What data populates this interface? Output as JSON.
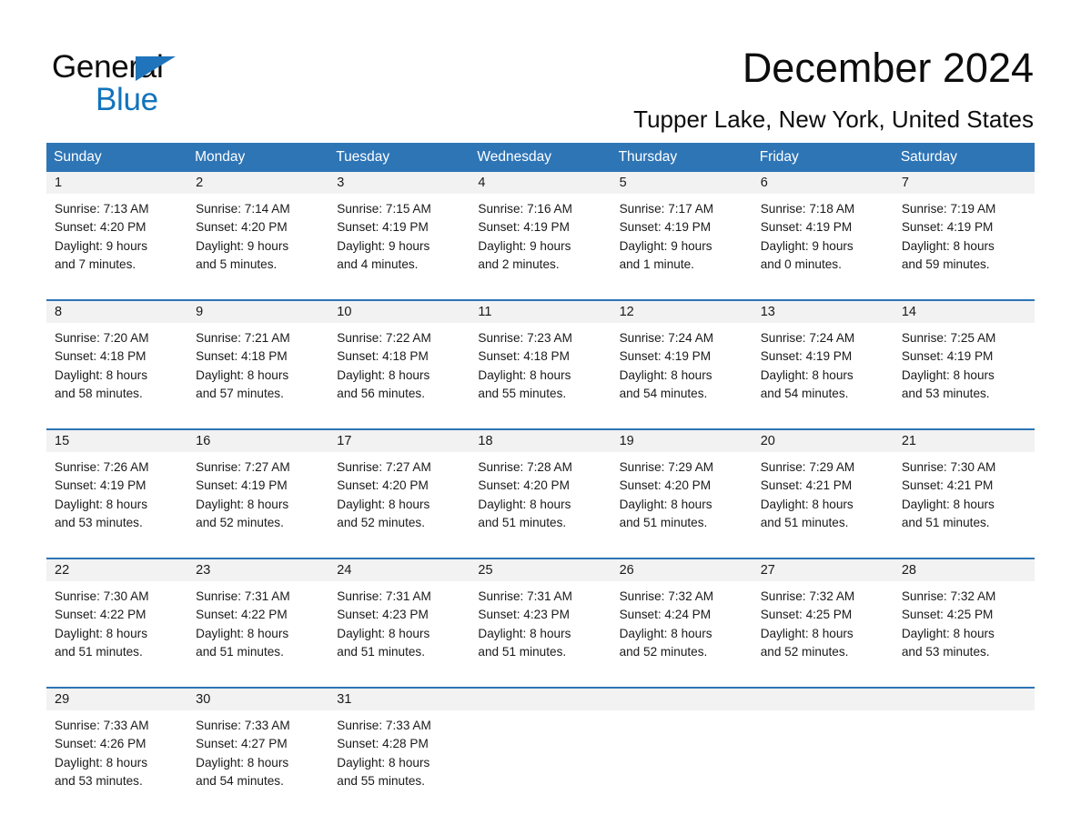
{
  "logo": {
    "line1": "General",
    "line2": "Blue",
    "triangle_color": "#1f74bb",
    "line2_color": "#1273bc"
  },
  "header": {
    "title": "December 2024",
    "subtitle": "Tupper Lake, New York, United States"
  },
  "colors": {
    "header_blue": "#2e75b6",
    "daynum_band": "#f2f2f2",
    "text": "#1a1a1a",
    "white": "#ffffff"
  },
  "weekdays": [
    "Sunday",
    "Monday",
    "Tuesday",
    "Wednesday",
    "Thursday",
    "Friday",
    "Saturday"
  ],
  "weeks": [
    [
      {
        "day": "1",
        "lines": [
          "Sunrise: 7:13 AM",
          "Sunset: 4:20 PM",
          "Daylight: 9 hours",
          "and 7 minutes."
        ]
      },
      {
        "day": "2",
        "lines": [
          "Sunrise: 7:14 AM",
          "Sunset: 4:20 PM",
          "Daylight: 9 hours",
          "and 5 minutes."
        ]
      },
      {
        "day": "3",
        "lines": [
          "Sunrise: 7:15 AM",
          "Sunset: 4:19 PM",
          "Daylight: 9 hours",
          "and 4 minutes."
        ]
      },
      {
        "day": "4",
        "lines": [
          "Sunrise: 7:16 AM",
          "Sunset: 4:19 PM",
          "Daylight: 9 hours",
          "and 2 minutes."
        ]
      },
      {
        "day": "5",
        "lines": [
          "Sunrise: 7:17 AM",
          "Sunset: 4:19 PM",
          "Daylight: 9 hours",
          "and 1 minute."
        ]
      },
      {
        "day": "6",
        "lines": [
          "Sunrise: 7:18 AM",
          "Sunset: 4:19 PM",
          "Daylight: 9 hours",
          "and 0 minutes."
        ]
      },
      {
        "day": "7",
        "lines": [
          "Sunrise: 7:19 AM",
          "Sunset: 4:19 PM",
          "Daylight: 8 hours",
          "and 59 minutes."
        ]
      }
    ],
    [
      {
        "day": "8",
        "lines": [
          "Sunrise: 7:20 AM",
          "Sunset: 4:18 PM",
          "Daylight: 8 hours",
          "and 58 minutes."
        ]
      },
      {
        "day": "9",
        "lines": [
          "Sunrise: 7:21 AM",
          "Sunset: 4:18 PM",
          "Daylight: 8 hours",
          "and 57 minutes."
        ]
      },
      {
        "day": "10",
        "lines": [
          "Sunrise: 7:22 AM",
          "Sunset: 4:18 PM",
          "Daylight: 8 hours",
          "and 56 minutes."
        ]
      },
      {
        "day": "11",
        "lines": [
          "Sunrise: 7:23 AM",
          "Sunset: 4:18 PM",
          "Daylight: 8 hours",
          "and 55 minutes."
        ]
      },
      {
        "day": "12",
        "lines": [
          "Sunrise: 7:24 AM",
          "Sunset: 4:19 PM",
          "Daylight: 8 hours",
          "and 54 minutes."
        ]
      },
      {
        "day": "13",
        "lines": [
          "Sunrise: 7:24 AM",
          "Sunset: 4:19 PM",
          "Daylight: 8 hours",
          "and 54 minutes."
        ]
      },
      {
        "day": "14",
        "lines": [
          "Sunrise: 7:25 AM",
          "Sunset: 4:19 PM",
          "Daylight: 8 hours",
          "and 53 minutes."
        ]
      }
    ],
    [
      {
        "day": "15",
        "lines": [
          "Sunrise: 7:26 AM",
          "Sunset: 4:19 PM",
          "Daylight: 8 hours",
          "and 53 minutes."
        ]
      },
      {
        "day": "16",
        "lines": [
          "Sunrise: 7:27 AM",
          "Sunset: 4:19 PM",
          "Daylight: 8 hours",
          "and 52 minutes."
        ]
      },
      {
        "day": "17",
        "lines": [
          "Sunrise: 7:27 AM",
          "Sunset: 4:20 PM",
          "Daylight: 8 hours",
          "and 52 minutes."
        ]
      },
      {
        "day": "18",
        "lines": [
          "Sunrise: 7:28 AM",
          "Sunset: 4:20 PM",
          "Daylight: 8 hours",
          "and 51 minutes."
        ]
      },
      {
        "day": "19",
        "lines": [
          "Sunrise: 7:29 AM",
          "Sunset: 4:20 PM",
          "Daylight: 8 hours",
          "and 51 minutes."
        ]
      },
      {
        "day": "20",
        "lines": [
          "Sunrise: 7:29 AM",
          "Sunset: 4:21 PM",
          "Daylight: 8 hours",
          "and 51 minutes."
        ]
      },
      {
        "day": "21",
        "lines": [
          "Sunrise: 7:30 AM",
          "Sunset: 4:21 PM",
          "Daylight: 8 hours",
          "and 51 minutes."
        ]
      }
    ],
    [
      {
        "day": "22",
        "lines": [
          "Sunrise: 7:30 AM",
          "Sunset: 4:22 PM",
          "Daylight: 8 hours",
          "and 51 minutes."
        ]
      },
      {
        "day": "23",
        "lines": [
          "Sunrise: 7:31 AM",
          "Sunset: 4:22 PM",
          "Daylight: 8 hours",
          "and 51 minutes."
        ]
      },
      {
        "day": "24",
        "lines": [
          "Sunrise: 7:31 AM",
          "Sunset: 4:23 PM",
          "Daylight: 8 hours",
          "and 51 minutes."
        ]
      },
      {
        "day": "25",
        "lines": [
          "Sunrise: 7:31 AM",
          "Sunset: 4:23 PM",
          "Daylight: 8 hours",
          "and 51 minutes."
        ]
      },
      {
        "day": "26",
        "lines": [
          "Sunrise: 7:32 AM",
          "Sunset: 4:24 PM",
          "Daylight: 8 hours",
          "and 52 minutes."
        ]
      },
      {
        "day": "27",
        "lines": [
          "Sunrise: 7:32 AM",
          "Sunset: 4:25 PM",
          "Daylight: 8 hours",
          "and 52 minutes."
        ]
      },
      {
        "day": "28",
        "lines": [
          "Sunrise: 7:32 AM",
          "Sunset: 4:25 PM",
          "Daylight: 8 hours",
          "and 53 minutes."
        ]
      }
    ],
    [
      {
        "day": "29",
        "lines": [
          "Sunrise: 7:33 AM",
          "Sunset: 4:26 PM",
          "Daylight: 8 hours",
          "and 53 minutes."
        ]
      },
      {
        "day": "30",
        "lines": [
          "Sunrise: 7:33 AM",
          "Sunset: 4:27 PM",
          "Daylight: 8 hours",
          "and 54 minutes."
        ]
      },
      {
        "day": "31",
        "lines": [
          "Sunrise: 7:33 AM",
          "Sunset: 4:28 PM",
          "Daylight: 8 hours",
          "and 55 minutes."
        ]
      },
      {
        "day": "",
        "lines": []
      },
      {
        "day": "",
        "lines": []
      },
      {
        "day": "",
        "lines": []
      },
      {
        "day": "",
        "lines": []
      }
    ]
  ]
}
